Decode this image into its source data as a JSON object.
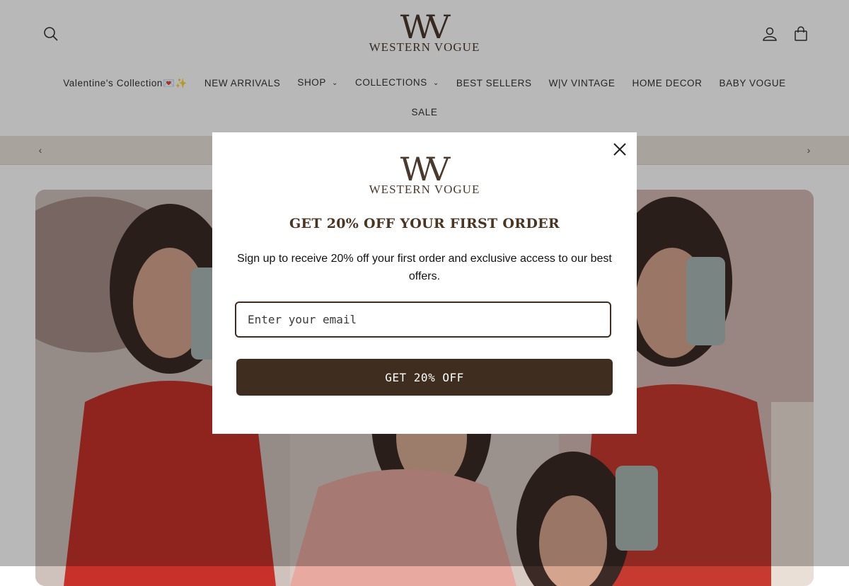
{
  "brand": {
    "monogram": "WV",
    "name": "WESTERN VOGUE"
  },
  "header": {
    "icons": {
      "search": "search-icon",
      "account": "account-icon",
      "cart": "cart-icon"
    }
  },
  "nav": {
    "items": [
      {
        "label": "Valentine's Collection💌✨",
        "dropdown": false
      },
      {
        "label": "NEW ARRIVALS",
        "dropdown": false
      },
      {
        "label": "SHOP",
        "dropdown": true
      },
      {
        "label": "COLLECTIONS",
        "dropdown": true
      },
      {
        "label": "BEST SELLERS",
        "dropdown": false
      },
      {
        "label": "W|V VINTAGE",
        "dropdown": false
      },
      {
        "label": "HOME DECOR",
        "dropdown": false
      },
      {
        "label": "BABY VOGUE",
        "dropdown": false
      }
    ],
    "second_row": "SALE"
  },
  "announcement": {
    "prev_icon": "‹",
    "next_icon": "›"
  },
  "popup": {
    "title": "GET 20% OFF YOUR FIRST ORDER",
    "text": "Sign up to receive 20% off your first order and exclusive access to our best offers.",
    "email_placeholder": "Enter your email",
    "button_label": "GET 20% OFF"
  },
  "colors": {
    "brand_brown": "#3f2e20",
    "announcement_bg": "#e9e3da"
  }
}
